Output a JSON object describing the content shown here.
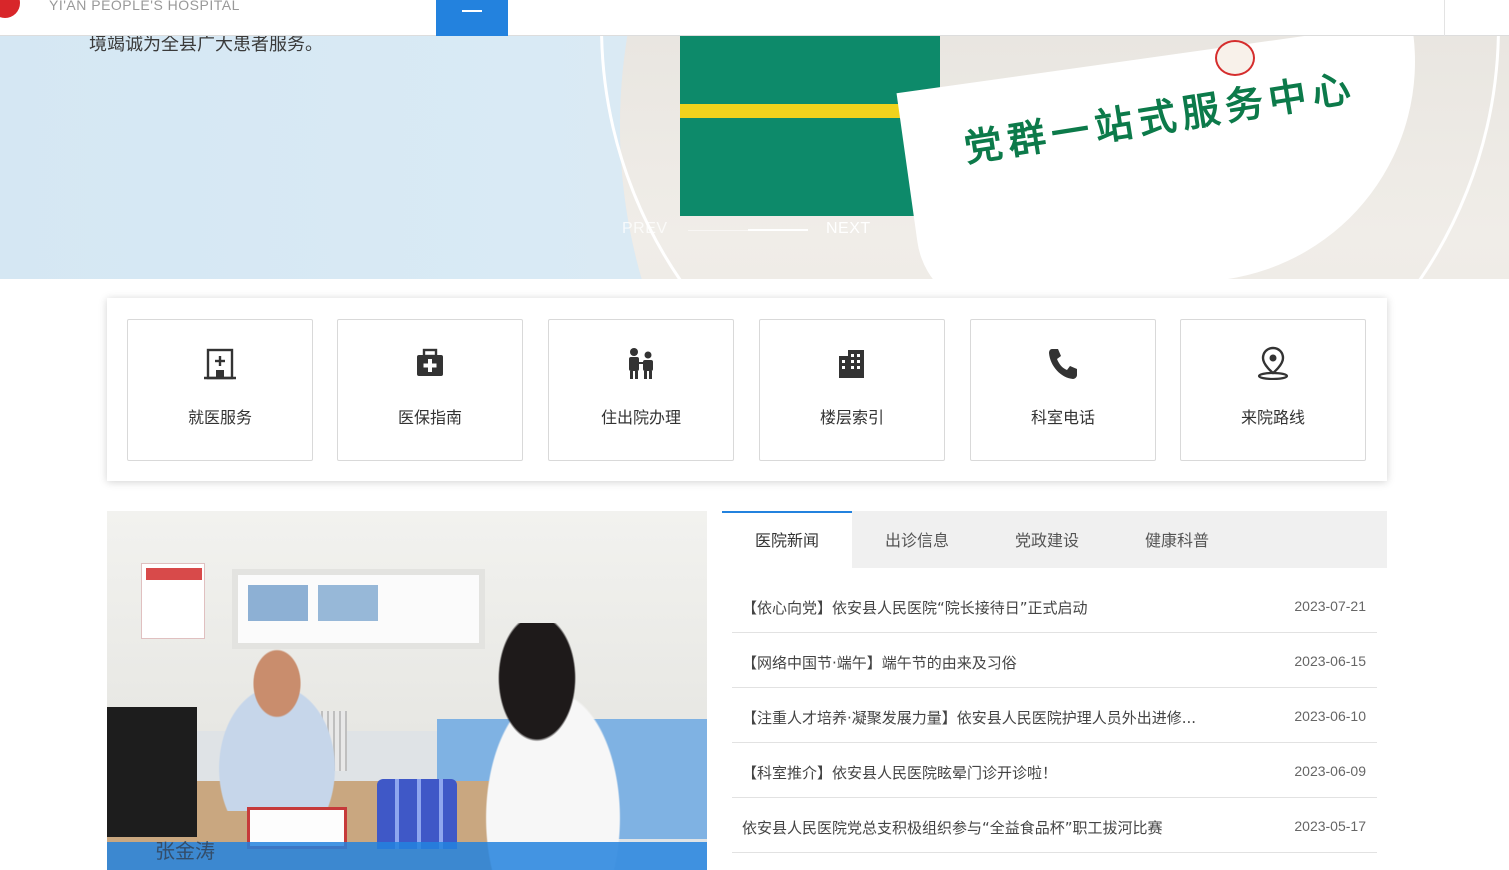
{
  "header": {
    "logo_subtitle": "YI'AN PEOPLE'S HOSPITAL",
    "menu_label": "menu-icon"
  },
  "banner": {
    "caption": "境竭诚为全县广大患者服务。",
    "sign_text": "党群一站式服务中心",
    "prev_label": "PREV",
    "next_label": "NEXT",
    "slide_progress": 0.5
  },
  "services": [
    {
      "label": "就医服务",
      "icon": "hospital-building-icon"
    },
    {
      "label": "医保指南",
      "icon": "medical-kit-icon"
    },
    {
      "label": "住出院办理",
      "icon": "patients-icon"
    },
    {
      "label": "楼层索引",
      "icon": "building-floors-icon"
    },
    {
      "label": "科室电话",
      "icon": "phone-icon"
    },
    {
      "label": "来院路线",
      "icon": "location-pin-icon"
    }
  ],
  "news_photo": {
    "caption": "张金涛"
  },
  "tabs": [
    {
      "label": "医院新闻",
      "active": true
    },
    {
      "label": "出诊信息",
      "active": false
    },
    {
      "label": "党政建设",
      "active": false
    },
    {
      "label": "健康科普",
      "active": false
    }
  ],
  "news": [
    {
      "title": "【依心向党】依安县人民医院“院长接待日”正式启动",
      "date": "2023-07-21"
    },
    {
      "title": "【网络中国节·端午】端午节的由来及习俗",
      "date": "2023-06-15"
    },
    {
      "title": "【注重人才培养·凝聚发展力量】依安县人民医院护理人员外出进修...",
      "date": "2023-06-10"
    },
    {
      "title": "【科室推介】依安县人民医院眩晕门诊开诊啦！",
      "date": "2023-06-09"
    },
    {
      "title": "依安县人民医院党总支积极组织参与“全益食品杯”职工拔河比赛",
      "date": "2023-05-17"
    }
  ],
  "colors": {
    "accent": "#2382de",
    "banner_bg": "#d7e8f3",
    "sign_green": "#0c7a4a"
  }
}
